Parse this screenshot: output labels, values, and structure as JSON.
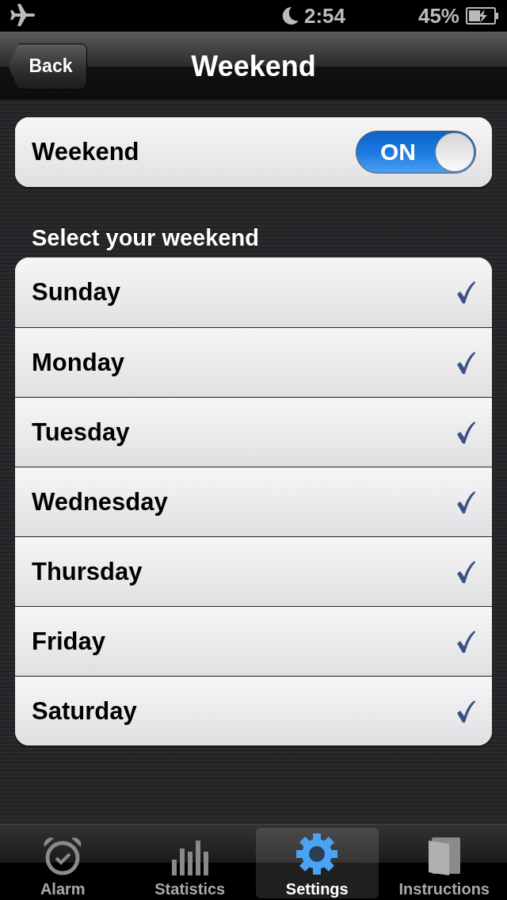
{
  "status_bar": {
    "time": "2:54",
    "battery": "45%"
  },
  "nav": {
    "back": "Back",
    "title": "Weekend"
  },
  "weekend_setting": {
    "label": "Weekend",
    "toggle_text": "ON",
    "on": true
  },
  "section_header": "Select your weekend",
  "days": [
    {
      "label": "Sunday",
      "checked": true
    },
    {
      "label": "Monday",
      "checked": true
    },
    {
      "label": "Tuesday",
      "checked": true
    },
    {
      "label": "Wednesday",
      "checked": true
    },
    {
      "label": "Thursday",
      "checked": true
    },
    {
      "label": "Friday",
      "checked": true
    },
    {
      "label": "Saturday",
      "checked": true
    }
  ],
  "tabs": [
    {
      "label": "Alarm",
      "kind": "alarm",
      "selected": false
    },
    {
      "label": "Statistics",
      "kind": "stats",
      "selected": false
    },
    {
      "label": "Settings",
      "kind": "settings",
      "selected": true
    },
    {
      "label": "Instructions",
      "kind": "book",
      "selected": false
    }
  ]
}
